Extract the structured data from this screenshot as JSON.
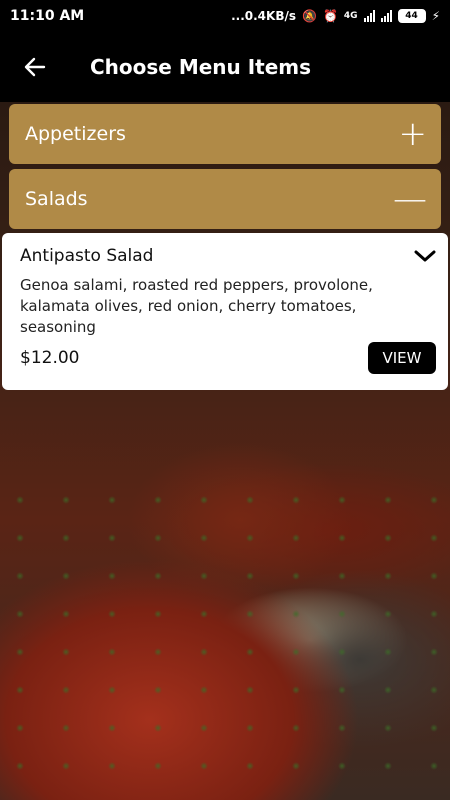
{
  "status_bar": {
    "time": "11:10 AM",
    "net_speed": "...0.4KB/s",
    "network_label": "4G",
    "battery": "44"
  },
  "header": {
    "title": "Choose Menu Items"
  },
  "categories": [
    {
      "label": "Appetizers",
      "toggle": "+"
    },
    {
      "label": "Salads",
      "toggle": "—"
    }
  ],
  "item": {
    "name": "Antipasto Salad",
    "description": "Genoa salami, roasted red peppers, provolone, kalamata olives, red onion, cherry tomatoes, seasoning",
    "price": "$12.00",
    "view_label": "VIEW"
  },
  "colors": {
    "category_bg": "#b08a47",
    "bar_bg": "#000000"
  }
}
